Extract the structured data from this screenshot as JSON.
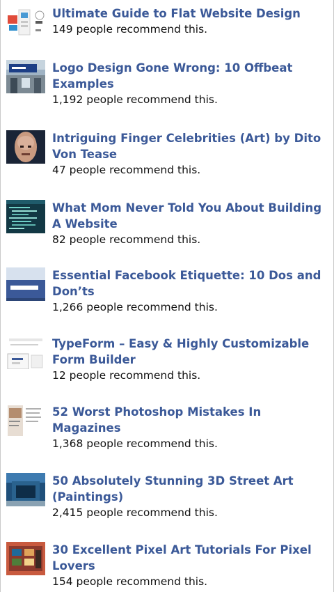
{
  "items": [
    {
      "title": "Ultimate Guide to Flat Website Design",
      "count": "149 people recommend this.",
      "thumb": "flat-design-thumbnail"
    },
    {
      "title": "Logo Design Gone Wrong: 10 Offbeat Examples",
      "count": "1,192 people recommend this.",
      "thumb": "storefront-logo-thumbnail"
    },
    {
      "title": "Intriguing Finger Celebrities (Art) by Dito Von Tease",
      "count": "47 people recommend this.",
      "thumb": "finger-face-thumbnail"
    },
    {
      "title": "What Mom Never Told You About Building A Website",
      "count": "82 people recommend this.",
      "thumb": "code-screen-thumbnail"
    },
    {
      "title": "Essential Facebook Etiquette: 10 Dos and Don’ts",
      "count": "1,266 people recommend this.",
      "thumb": "facebook-logo-thumbnail"
    },
    {
      "title": "TypeForm – Easy & Highly Customizable Form Builder",
      "count": "12 people recommend this.",
      "thumb": "form-builder-thumbnail"
    },
    {
      "title": "52 Worst Photoshop Mistakes In Magazines",
      "count": "1,368 people recommend this.",
      "thumb": "magazine-thumbnail"
    },
    {
      "title": "50 Absolutely Stunning 3D Street Art (Paintings)",
      "count": "2,415 people recommend this.",
      "thumb": "street-art-thumbnail"
    },
    {
      "title": "30 Excellent Pixel Art Tutorials For Pixel Lovers",
      "count": "154 people recommend this.",
      "thumb": "pixel-art-thumbnail"
    }
  ],
  "colors": {
    "link": "#3b5998",
    "text": "#111111"
  }
}
